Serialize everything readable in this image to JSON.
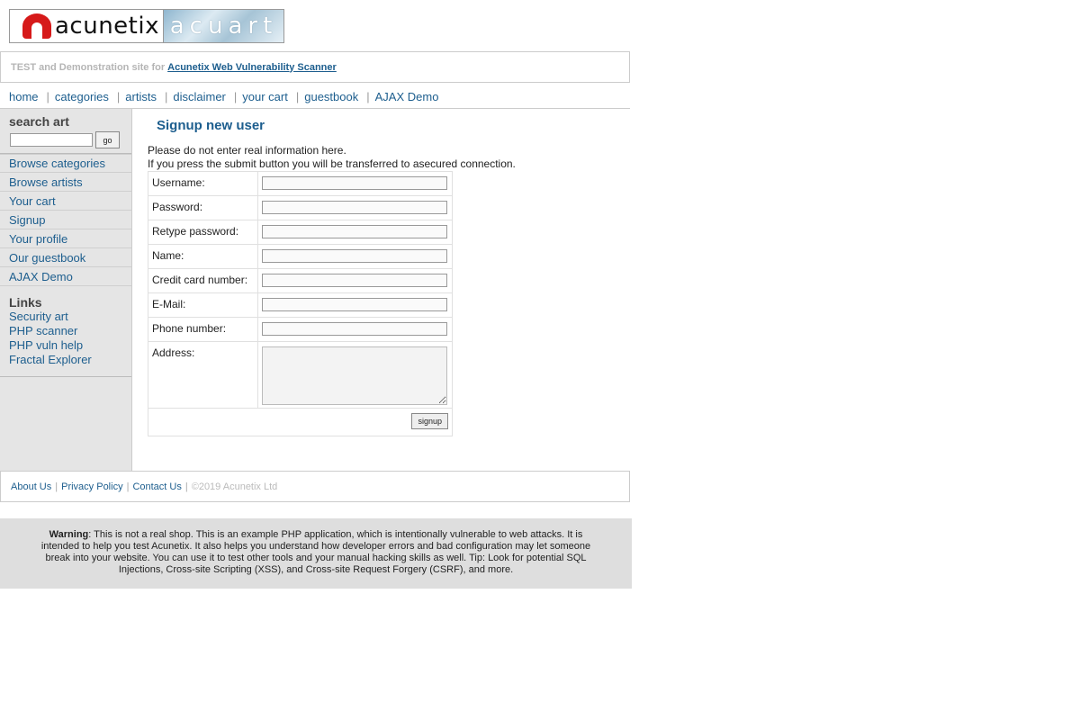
{
  "logo": {
    "brand": "acunetix",
    "product": "acuart"
  },
  "subtitle": {
    "prefix": "TEST and Demonstration site for",
    "link": "Acunetix Web Vulnerability Scanner"
  },
  "top_nav": [
    "home",
    "categories",
    "artists",
    "disclaimer",
    "your cart",
    "guestbook",
    "AJAX Demo"
  ],
  "sidebar": {
    "search_title": "search art",
    "search_button": "go",
    "nav": [
      "Browse categories",
      "Browse artists",
      "Your cart",
      "Signup",
      "Your profile",
      "Our guestbook",
      "AJAX Demo"
    ],
    "links_title": "Links",
    "links": [
      "Security art",
      "PHP scanner",
      "PHP vuln help",
      "Fractal Explorer"
    ]
  },
  "main": {
    "heading": "Signup new user",
    "notice_line1": "Please do not enter real information here.",
    "notice_line2": "If you press the submit button you will be transferred to asecured connection.",
    "fields": [
      "Username:",
      "Password:",
      "Retype password:",
      "Name:",
      "Credit card number:",
      "E-Mail:",
      "Phone number:",
      "Address:"
    ],
    "submit_label": "signup"
  },
  "footer": {
    "links": [
      "About Us",
      "Privacy Policy",
      "Contact Us"
    ],
    "copyright": "©2019 Acunetix Ltd"
  },
  "warning": {
    "label": "Warning",
    "text": ": This is not a real shop. This is an example PHP application, which is intentionally vulnerable to web attacks. It is intended to help you test Acunetix. It also helps you understand how developer errors and bad configuration may let someone break into your website. You can use it to test other tools and your manual hacking skills as well. Tip: Look for potential SQL Injections, Cross-site Scripting (XSS), and Cross-site Request Forgery (CSRF), and more."
  }
}
